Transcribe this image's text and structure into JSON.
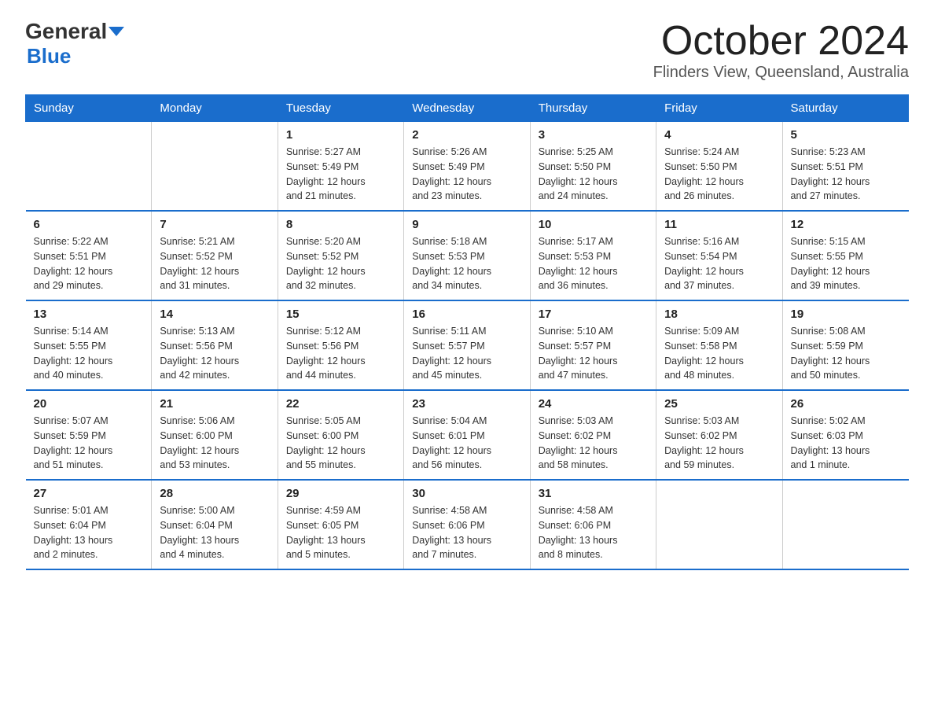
{
  "header": {
    "logo_line1": "General",
    "logo_line2": "Blue",
    "month": "October 2024",
    "location": "Flinders View, Queensland, Australia"
  },
  "days_of_week": [
    "Sunday",
    "Monday",
    "Tuesday",
    "Wednesday",
    "Thursday",
    "Friday",
    "Saturday"
  ],
  "weeks": [
    [
      {
        "day": "",
        "info": ""
      },
      {
        "day": "",
        "info": ""
      },
      {
        "day": "1",
        "info": "Sunrise: 5:27 AM\nSunset: 5:49 PM\nDaylight: 12 hours\nand 21 minutes."
      },
      {
        "day": "2",
        "info": "Sunrise: 5:26 AM\nSunset: 5:49 PM\nDaylight: 12 hours\nand 23 minutes."
      },
      {
        "day": "3",
        "info": "Sunrise: 5:25 AM\nSunset: 5:50 PM\nDaylight: 12 hours\nand 24 minutes."
      },
      {
        "day": "4",
        "info": "Sunrise: 5:24 AM\nSunset: 5:50 PM\nDaylight: 12 hours\nand 26 minutes."
      },
      {
        "day": "5",
        "info": "Sunrise: 5:23 AM\nSunset: 5:51 PM\nDaylight: 12 hours\nand 27 minutes."
      }
    ],
    [
      {
        "day": "6",
        "info": "Sunrise: 5:22 AM\nSunset: 5:51 PM\nDaylight: 12 hours\nand 29 minutes."
      },
      {
        "day": "7",
        "info": "Sunrise: 5:21 AM\nSunset: 5:52 PM\nDaylight: 12 hours\nand 31 minutes."
      },
      {
        "day": "8",
        "info": "Sunrise: 5:20 AM\nSunset: 5:52 PM\nDaylight: 12 hours\nand 32 minutes."
      },
      {
        "day": "9",
        "info": "Sunrise: 5:18 AM\nSunset: 5:53 PM\nDaylight: 12 hours\nand 34 minutes."
      },
      {
        "day": "10",
        "info": "Sunrise: 5:17 AM\nSunset: 5:53 PM\nDaylight: 12 hours\nand 36 minutes."
      },
      {
        "day": "11",
        "info": "Sunrise: 5:16 AM\nSunset: 5:54 PM\nDaylight: 12 hours\nand 37 minutes."
      },
      {
        "day": "12",
        "info": "Sunrise: 5:15 AM\nSunset: 5:55 PM\nDaylight: 12 hours\nand 39 minutes."
      }
    ],
    [
      {
        "day": "13",
        "info": "Sunrise: 5:14 AM\nSunset: 5:55 PM\nDaylight: 12 hours\nand 40 minutes."
      },
      {
        "day": "14",
        "info": "Sunrise: 5:13 AM\nSunset: 5:56 PM\nDaylight: 12 hours\nand 42 minutes."
      },
      {
        "day": "15",
        "info": "Sunrise: 5:12 AM\nSunset: 5:56 PM\nDaylight: 12 hours\nand 44 minutes."
      },
      {
        "day": "16",
        "info": "Sunrise: 5:11 AM\nSunset: 5:57 PM\nDaylight: 12 hours\nand 45 minutes."
      },
      {
        "day": "17",
        "info": "Sunrise: 5:10 AM\nSunset: 5:57 PM\nDaylight: 12 hours\nand 47 minutes."
      },
      {
        "day": "18",
        "info": "Sunrise: 5:09 AM\nSunset: 5:58 PM\nDaylight: 12 hours\nand 48 minutes."
      },
      {
        "day": "19",
        "info": "Sunrise: 5:08 AM\nSunset: 5:59 PM\nDaylight: 12 hours\nand 50 minutes."
      }
    ],
    [
      {
        "day": "20",
        "info": "Sunrise: 5:07 AM\nSunset: 5:59 PM\nDaylight: 12 hours\nand 51 minutes."
      },
      {
        "day": "21",
        "info": "Sunrise: 5:06 AM\nSunset: 6:00 PM\nDaylight: 12 hours\nand 53 minutes."
      },
      {
        "day": "22",
        "info": "Sunrise: 5:05 AM\nSunset: 6:00 PM\nDaylight: 12 hours\nand 55 minutes."
      },
      {
        "day": "23",
        "info": "Sunrise: 5:04 AM\nSunset: 6:01 PM\nDaylight: 12 hours\nand 56 minutes."
      },
      {
        "day": "24",
        "info": "Sunrise: 5:03 AM\nSunset: 6:02 PM\nDaylight: 12 hours\nand 58 minutes."
      },
      {
        "day": "25",
        "info": "Sunrise: 5:03 AM\nSunset: 6:02 PM\nDaylight: 12 hours\nand 59 minutes."
      },
      {
        "day": "26",
        "info": "Sunrise: 5:02 AM\nSunset: 6:03 PM\nDaylight: 13 hours\nand 1 minute."
      }
    ],
    [
      {
        "day": "27",
        "info": "Sunrise: 5:01 AM\nSunset: 6:04 PM\nDaylight: 13 hours\nand 2 minutes."
      },
      {
        "day": "28",
        "info": "Sunrise: 5:00 AM\nSunset: 6:04 PM\nDaylight: 13 hours\nand 4 minutes."
      },
      {
        "day": "29",
        "info": "Sunrise: 4:59 AM\nSunset: 6:05 PM\nDaylight: 13 hours\nand 5 minutes."
      },
      {
        "day": "30",
        "info": "Sunrise: 4:58 AM\nSunset: 6:06 PM\nDaylight: 13 hours\nand 7 minutes."
      },
      {
        "day": "31",
        "info": "Sunrise: 4:58 AM\nSunset: 6:06 PM\nDaylight: 13 hours\nand 8 minutes."
      },
      {
        "day": "",
        "info": ""
      },
      {
        "day": "",
        "info": ""
      }
    ]
  ]
}
